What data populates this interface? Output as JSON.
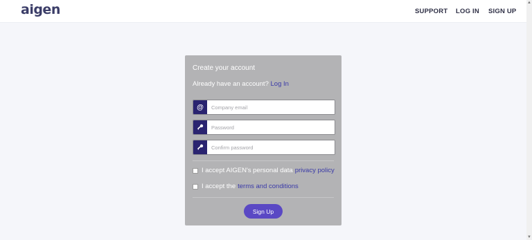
{
  "header": {
    "logo_text": "aigen",
    "nav": {
      "support": "SUPPORT",
      "login": "LOG IN",
      "signup": "SIGN UP"
    }
  },
  "form": {
    "title": "Create your account",
    "have_account_text": "Already have an account?",
    "login_link": "Log In",
    "email": {
      "icon": "at-icon",
      "placeholder": "Company email",
      "value": ""
    },
    "password": {
      "icon": "key-icon",
      "placeholder": "Password",
      "value": ""
    },
    "confirm_password": {
      "icon": "key-icon",
      "placeholder": "Confirm password",
      "value": ""
    },
    "privacy": {
      "text": "I accept AIGEN's personal data",
      "link": "privacy policy",
      "checked": false
    },
    "terms": {
      "text": "I accept the",
      "link": "terms and conditions",
      "checked": false
    },
    "submit_label": "Sign Up"
  },
  "colors": {
    "brand_dark": "#2a2470",
    "button": "#5a48c4",
    "link": "#3a3aa8",
    "card": "#b3b3b5",
    "background": "#f5f6fa"
  }
}
